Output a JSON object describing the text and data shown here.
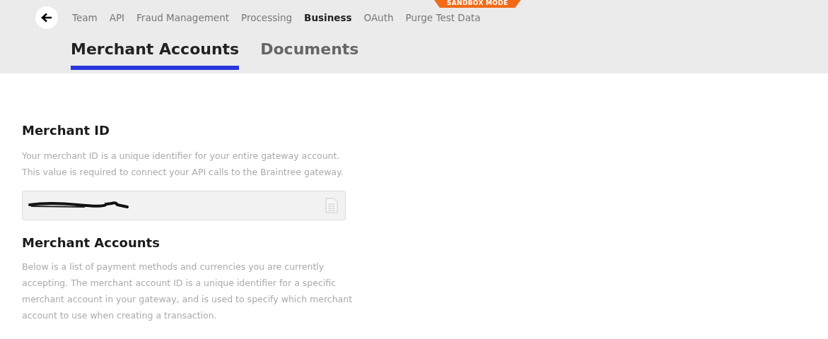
{
  "header": {
    "badge": "SANDBOX MODE",
    "nav": [
      {
        "label": "Team",
        "selected": false
      },
      {
        "label": "API",
        "selected": false
      },
      {
        "label": "Fraud Management",
        "selected": false
      },
      {
        "label": "Processing",
        "selected": false
      },
      {
        "label": "Business",
        "selected": true
      },
      {
        "label": "OAuth",
        "selected": false
      },
      {
        "label": "Purge Test Data",
        "selected": false
      }
    ],
    "tabs": [
      {
        "label": "Merchant Accounts",
        "selected": true
      },
      {
        "label": "Documents",
        "selected": false
      }
    ]
  },
  "sections": [
    {
      "title": "Merchant ID",
      "paragraphs": [
        "Your merchant ID is a unique identifier for your entire gateway account.",
        "This value is required to connect your API calls to the Braintree gateway."
      ],
      "field": {
        "redacted": true
      }
    },
    {
      "title": "Merchant Accounts",
      "paragraphs": [
        "Below is a list of payment methods and currencies you are currently accepting. The merchant account ID is a unique identifier for a specific merchant account in your gateway, and is used to specify which merchant account to use when creating a transaction."
      ]
    }
  ]
}
